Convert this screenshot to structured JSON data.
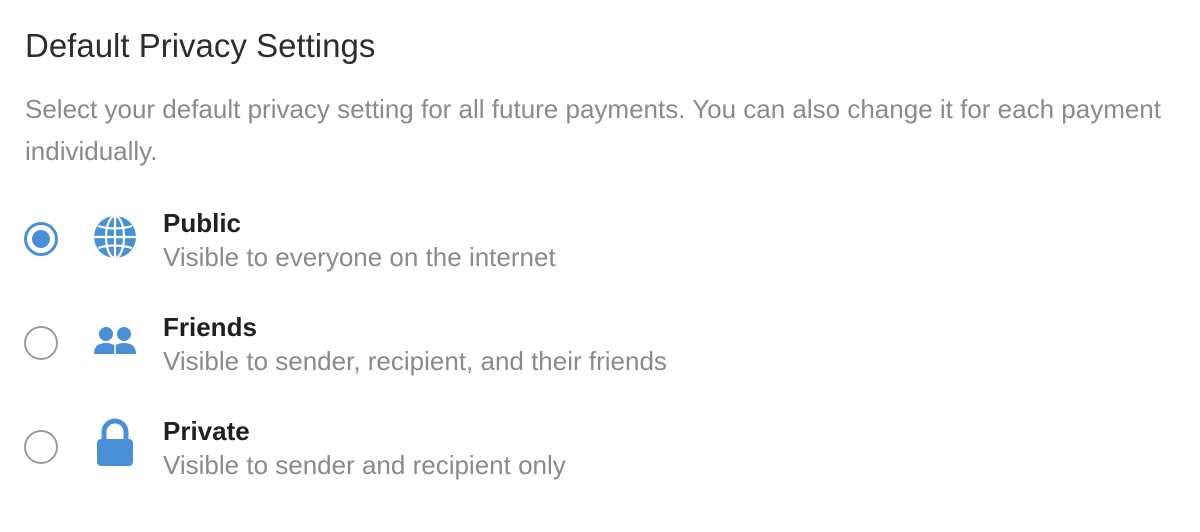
{
  "header": {
    "title": "Default Privacy Settings",
    "description": "Select your default privacy setting for all future payments. You can also change it for each payment individually."
  },
  "accent_color": "#4a90d9",
  "options": [
    {
      "label": "Public",
      "sublabel": "Visible to everyone on the internet",
      "icon": "globe-icon",
      "selected": true
    },
    {
      "label": "Friends",
      "sublabel": "Visible to sender, recipient, and their friends",
      "icon": "friends-icon",
      "selected": false
    },
    {
      "label": "Private",
      "sublabel": "Visible to sender and recipient only",
      "icon": "lock-icon",
      "selected": false
    }
  ]
}
